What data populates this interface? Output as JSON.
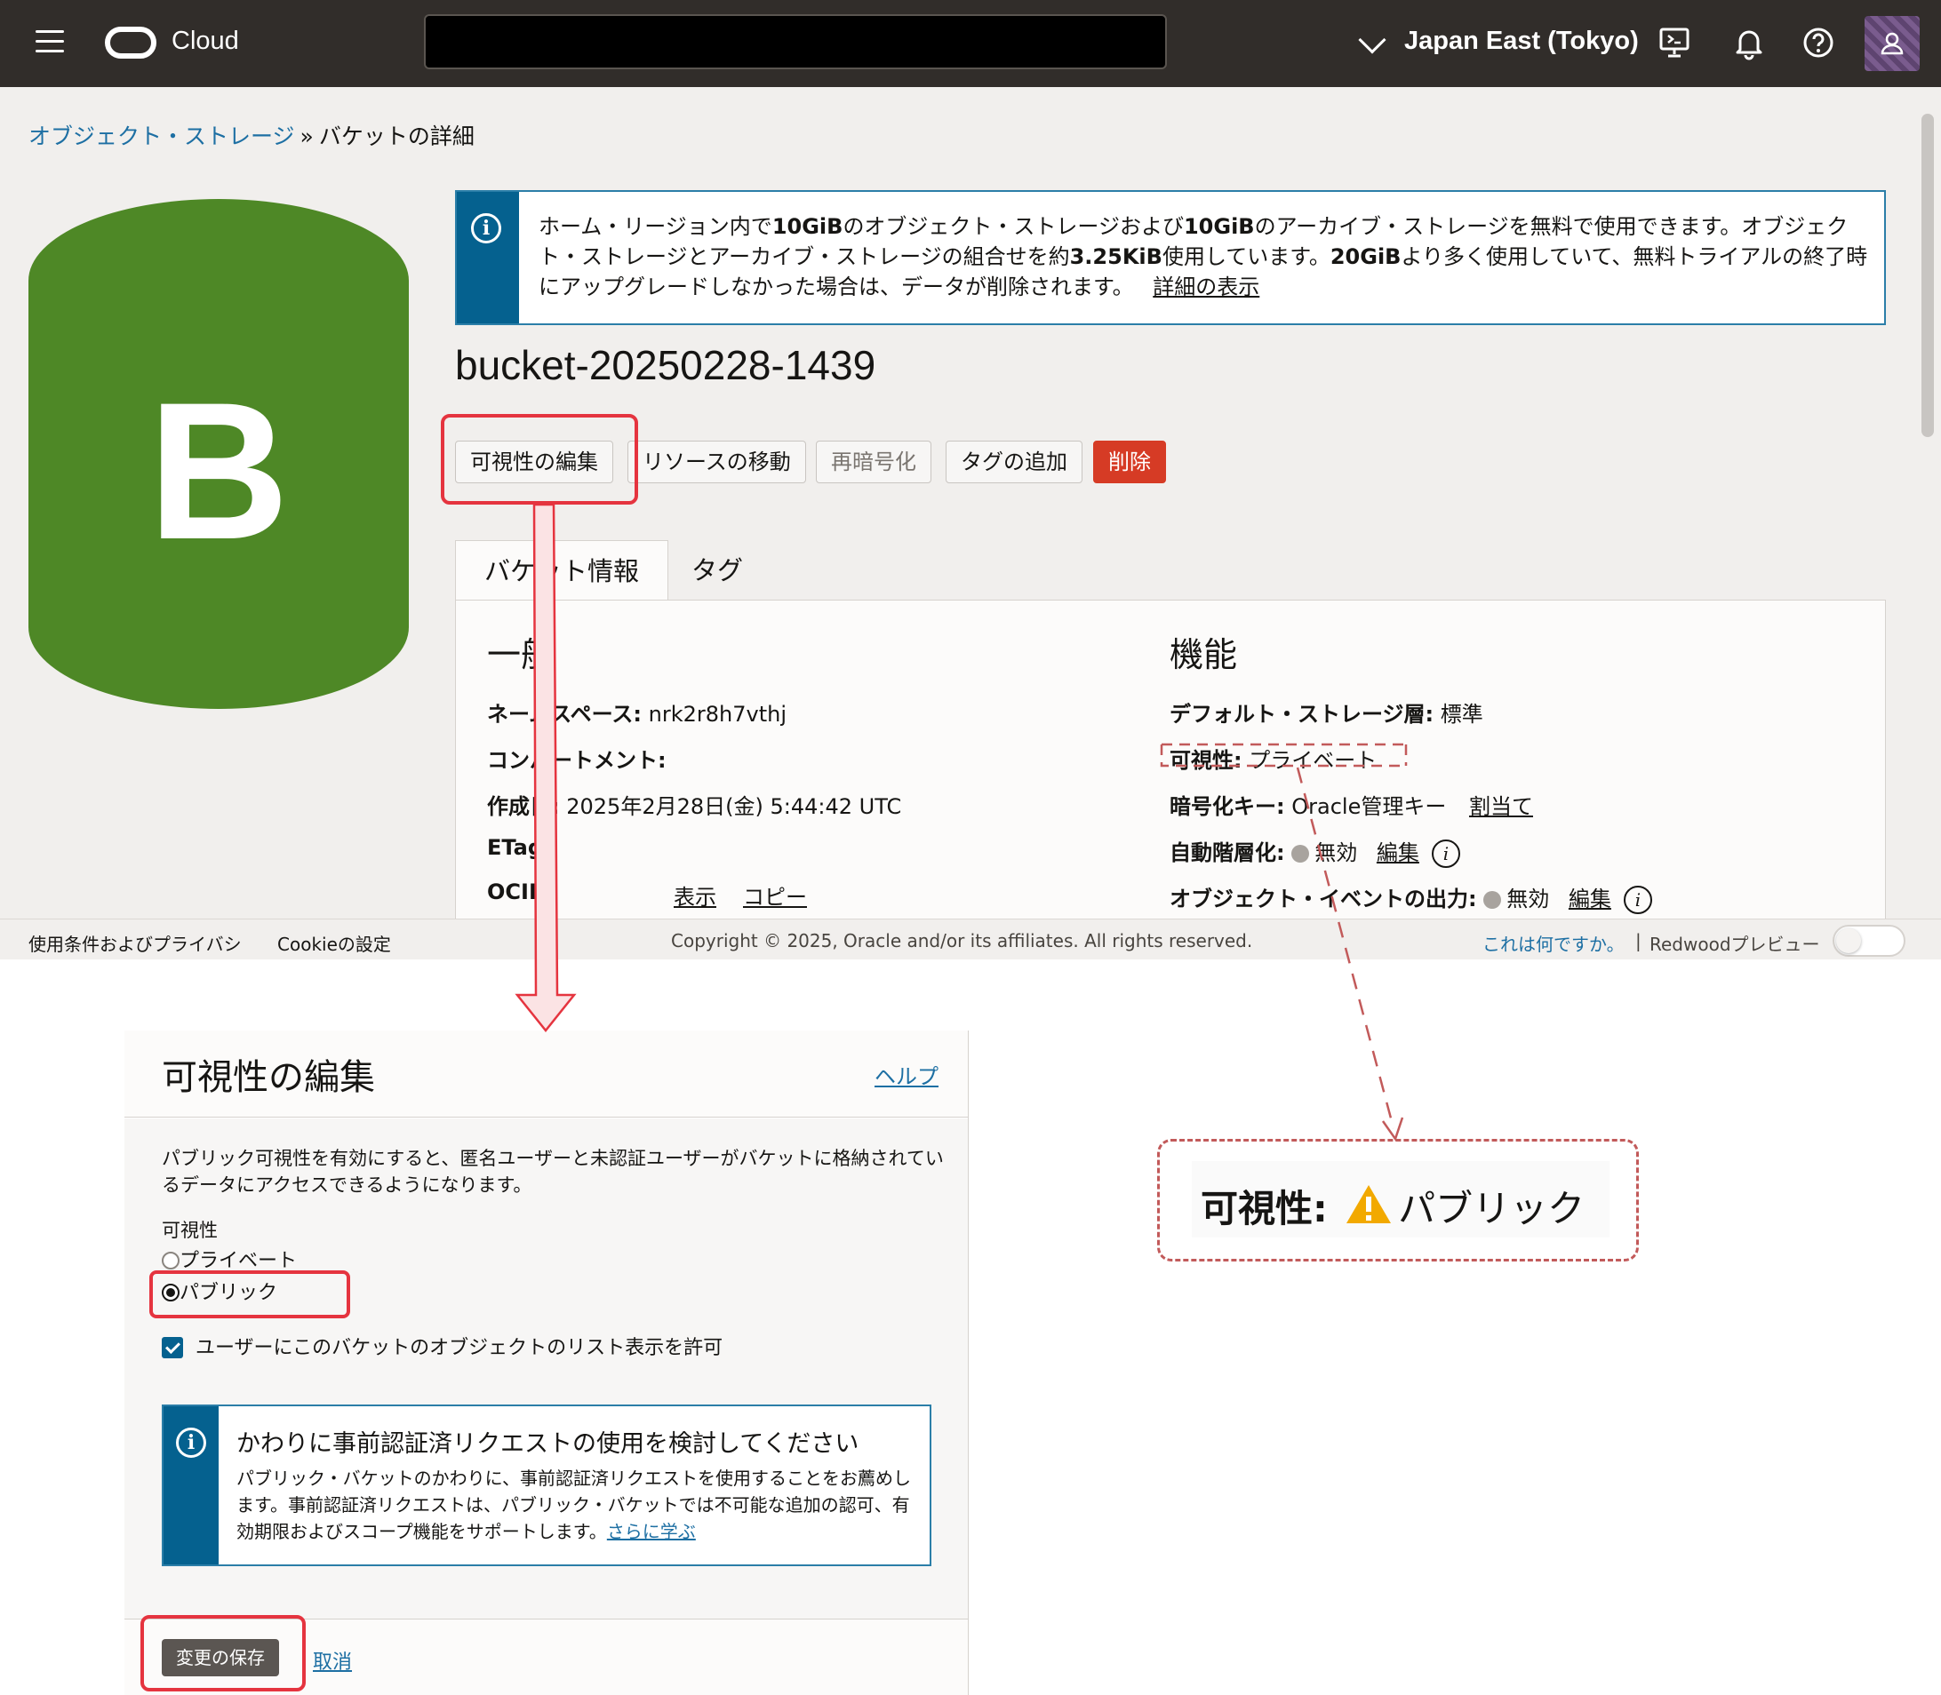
{
  "topbar": {
    "brand": "Cloud",
    "region": "Japan East (Tokyo)"
  },
  "breadcrumb": {
    "parent": "オブジェクト・ストレージ",
    "separator": "»",
    "current": "バケットの詳細"
  },
  "bucket_icon_letter": "B",
  "banner": {
    "t1": "ホーム・リージョン内で",
    "b1": "10GiB",
    "t2": "のオブジェクト・ストレージおよび",
    "b2": "10GiB",
    "t3": "のアーカイブ・ストレージを無料で使用できます。オブジェクト・ストレージとアーカイブ・ストレージの組合せを約",
    "b3": "3.25KiB",
    "t4": "使用しています。",
    "b4": "20GiB",
    "t5": "より多く使用していて、無料トライアルの終了時にアップグレードしなかった場合は、データが削除されます。",
    "link": "詳細の表示"
  },
  "bucket_name": "bucket-20250228-1439",
  "actions": {
    "edit_visibility": "可視性の編集",
    "move_resource": "リソースの移動",
    "re_encrypt": "再暗号化",
    "add_tags": "タグの追加",
    "delete": "削除"
  },
  "tabs": {
    "bucket_info": "バケット情報",
    "tags": "タグ"
  },
  "general": {
    "title": "一般",
    "namespace_label": "ネームスペース:",
    "namespace_value": "nrk2r8h7vthj",
    "compartment_label": "コンパートメント:",
    "created_label": "作成日:",
    "created_value": "2025年2月28日(金) 5:44:42 UTC",
    "etag_label": "ETag:",
    "ocid_label": "OCID:",
    "show": "表示",
    "copy": "コピー"
  },
  "features": {
    "title": "機能",
    "storage_tier_label": "デフォルト・ストレージ層:",
    "storage_tier_value": "標準",
    "visibility_label": "可視性:",
    "visibility_value": "プライベート",
    "encryption_label": "暗号化キー:",
    "encryption_value": "Oracle管理キー",
    "assign": "割当て",
    "auto_tiering_label": "自動階層化:",
    "auto_tiering_value": "無効",
    "edit": "編集",
    "events_label": "オブジェクト・イベントの出力:",
    "events_value": "無効"
  },
  "footer": {
    "terms": "使用条件およびプライバシ",
    "cookie": "Cookieの設定",
    "copyright": "Copyright © 2025, Oracle and/or its affiliates. All rights reserved.",
    "what_is_this": "これは何ですか。",
    "divider": "|",
    "redwood": "Redwoodプレビュー"
  },
  "dialog": {
    "title": "可視性の編集",
    "help": "ヘルプ",
    "description": "パブリック可視性を有効にすると、匿名ユーザーと未認証ユーザーがバケットに格納されているデータにアクセスできるようになります。",
    "visibility_label": "可視性",
    "option_private": "プライベート",
    "option_public": "パブリック",
    "selected": "public",
    "allow_list": "ユーザーにこのバケットのオブジェクトのリスト表示を許可",
    "note_title": "かわりに事前認証済リクエストの使用を検討してください",
    "note_text": "パブリック・バケットのかわりに、事前認証済リクエストを使用することをお薦めします。事前認証済リクエストは、パブリック・バケットでは不可能な追加の認可、有効期限およびスコープ機能をサポートします。",
    "learn_more": "さらに学ぶ",
    "save": "変更の保存",
    "cancel": "取消"
  },
  "callout": {
    "label": "可視性:",
    "value": "パブリック"
  },
  "colors": {
    "topbar": "#312d2a",
    "bucket_green": "#4e8826",
    "info_blue": "#05618f",
    "danger": "#d63b25",
    "highlight_red": "#e5343f",
    "warning": "#f2a900"
  }
}
